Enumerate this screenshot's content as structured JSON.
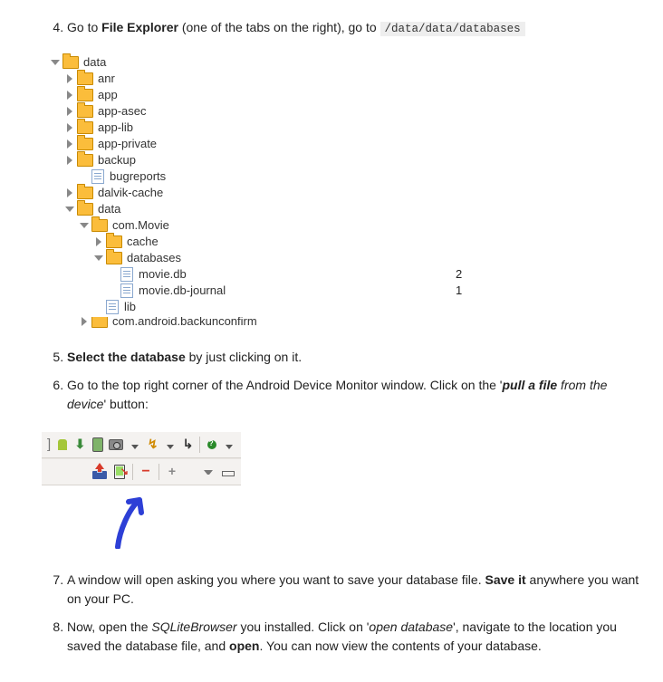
{
  "steps": {
    "s4_prefix": "Go to ",
    "s4_bold": "File Explorer",
    "s4_mid": " (one of the tabs on the right), go to ",
    "s4_code": "/data/data/databases",
    "s5_bold": "Select the database",
    "s5_rest": " by just clicking on it.",
    "s6_a": "Go to the top right corner of the Android Device Monitor window. Click on the '",
    "s6_bold": "pull a file",
    "s6_ital": " from the device",
    "s6_b": "' button:",
    "s7_a": "A window will open asking you where you want to save your database file. ",
    "s7_bold": "Save it",
    "s7_b": " anywhere you want on your PC.",
    "s8_a": "Now, open the ",
    "s8_ital": "SQLiteBrowser",
    "s8_b": " you installed. Click on '",
    "s8_ital2": "open database",
    "s8_c": "', navigate to the location you saved the database file, and ",
    "s8_bold": "open",
    "s8_d": ". You can now view the contents of your database."
  },
  "tree": {
    "data": "data",
    "anr": "anr",
    "app": "app",
    "app_asec": "app-asec",
    "app_lib": "app-lib",
    "app_private": "app-private",
    "backup": "backup",
    "bugreports": "bugreports",
    "dalvik": "dalvik-cache",
    "data2": "data",
    "movie_pkg": "com.Movie",
    "cache": "cache",
    "databases": "databases",
    "moviedb": "movie.db",
    "moviedb_size": "2",
    "moviedbj": "movie.db-journal",
    "moviedbj_size": "1",
    "lib": "lib",
    "backunconfirm": "com.android.backunconfirm"
  }
}
